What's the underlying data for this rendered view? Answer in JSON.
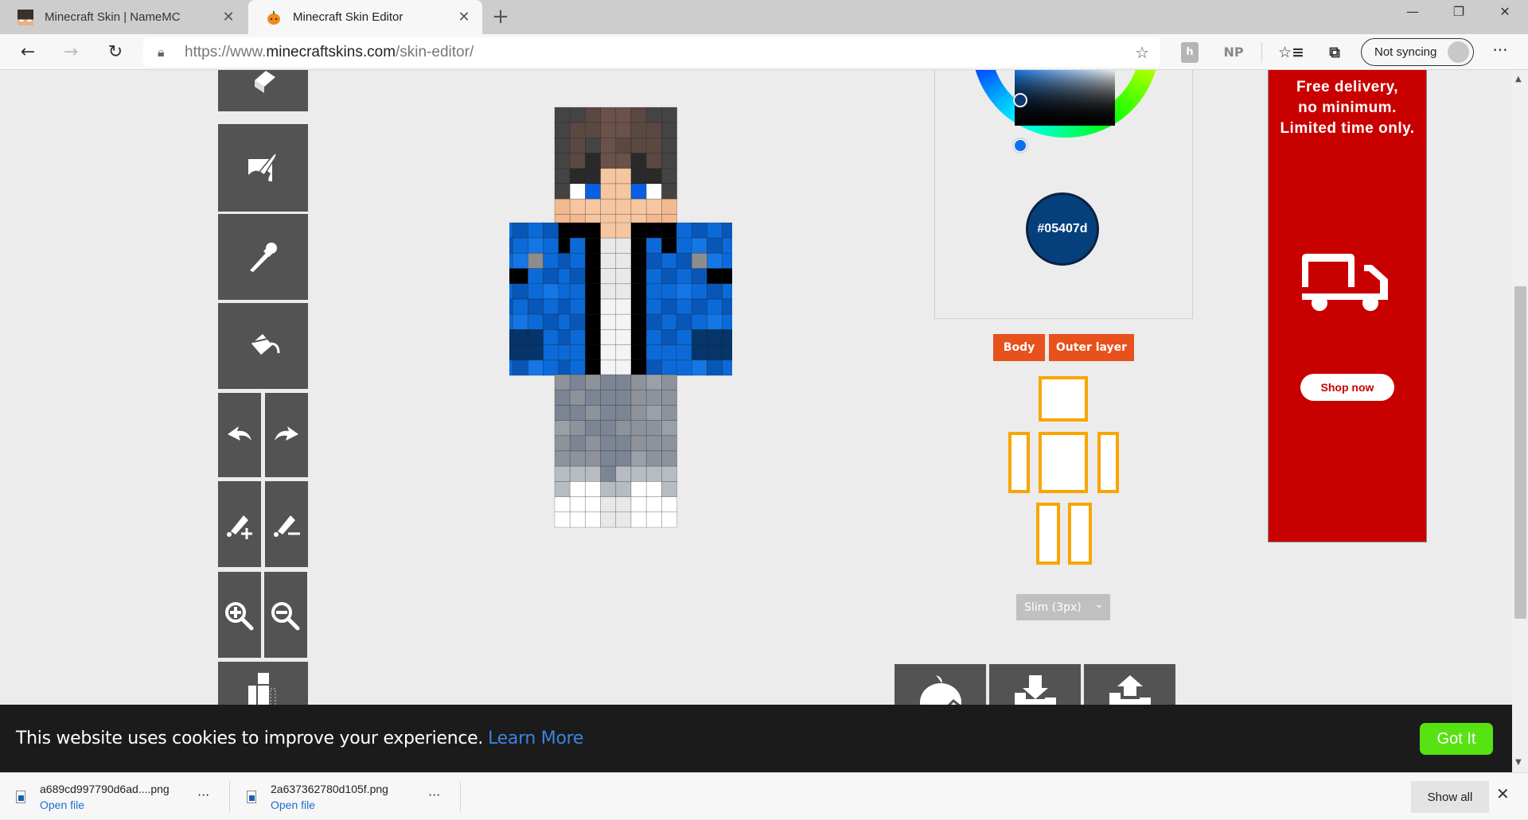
{
  "browser": {
    "tabs": [
      {
        "title": "Minecraft Skin | NameMC",
        "active": false,
        "favicon": "minecraft-head-icon"
      },
      {
        "title": "Minecraft Skin Editor",
        "active": true,
        "favicon": "pumpkin-icon"
      }
    ],
    "new_tab": "+",
    "window_controls": {
      "minimize": "—",
      "restore": "❐",
      "close": "✕"
    },
    "nav": {
      "back": "←",
      "forward": "→",
      "reload": "↻"
    },
    "url": {
      "scheme": "https://www.",
      "host": "minecraftskins.com",
      "path": "/skin-editor/"
    },
    "extensions": [
      "h",
      "NP"
    ],
    "sync_label": "Not syncing",
    "more": "···"
  },
  "editor": {
    "tools": [
      {
        "name": "eraser",
        "icon": "eraser-icon"
      },
      {
        "name": "paint brush",
        "icon": "paint-brush-icon"
      },
      {
        "name": "color picker",
        "icon": "eyedropper-icon"
      },
      {
        "name": "paint bucket",
        "icon": "paint-bucket-icon"
      },
      {
        "name": "undo",
        "icon": "undo-icon"
      },
      {
        "name": "redo",
        "icon": "redo-icon"
      },
      {
        "name": "lighten",
        "icon": "brush-plus-icon"
      },
      {
        "name": "darken",
        "icon": "brush-minus-icon"
      },
      {
        "name": "zoom in",
        "icon": "zoom-in-icon"
      },
      {
        "name": "zoom out",
        "icon": "zoom-out-icon"
      },
      {
        "name": "toggle parts",
        "icon": "body-parts-icon"
      }
    ],
    "color": {
      "hex": "#05407d"
    },
    "layers": {
      "body_label": "Body",
      "outer_label": "Outer layer"
    },
    "parts": [
      "head",
      "right-arm",
      "torso",
      "left-arm",
      "right-leg",
      "left-leg"
    ],
    "arm_model": "Slim (3px)",
    "bottom_actions": [
      {
        "name": "new skin",
        "icon": "pumpkin-icon"
      },
      {
        "name": "download",
        "icon": "download-icon"
      },
      {
        "name": "upload",
        "icon": "upload-icon"
      }
    ],
    "colors": {
      "accent": "#e8501c",
      "part_outline": "#f9a500",
      "tool_bg": "#535353"
    }
  },
  "ad": {
    "headline_lines": [
      "Free delivery,",
      "no minimum.",
      "Limited time only."
    ],
    "cta": "Shop now",
    "bg_color": "#c90000"
  },
  "cookie": {
    "message": "This website uses cookies to improve your experience.",
    "learn_more": "Learn More",
    "accept": "Got It"
  },
  "downloads": [
    {
      "filename": "a689cd997790d6ad....png",
      "action": "Open file"
    },
    {
      "filename": "2a637362780d105f.png",
      "action": "Open file"
    }
  ],
  "downloads_show_all": "Show all",
  "downloads_close": "✕"
}
